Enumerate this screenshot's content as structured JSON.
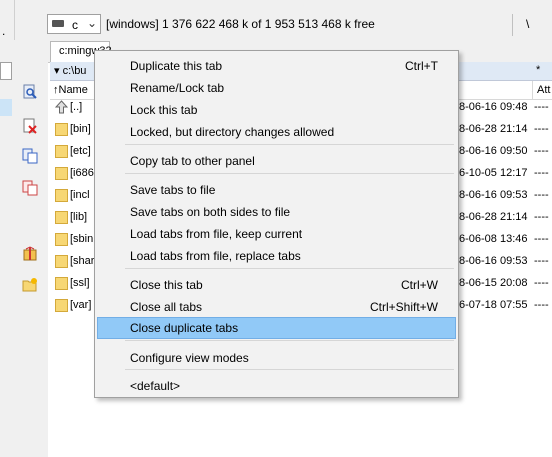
{
  "drive": {
    "letter": "c",
    "info": "[windows]  1 376 622 468 k of 1 953 513 468 k free",
    "right_sep": "\\"
  },
  "left_panel": {
    "dot": "."
  },
  "tab": {
    "label": "c:mingw32"
  },
  "path": {
    "text": "c:\\bu",
    "star": "*"
  },
  "columns": {
    "name": "↑Name",
    "attr": "Att"
  },
  "rows": [
    {
      "name": "[..]",
      "date": "8-06-16 09:48",
      "attr": "----",
      "type": "up"
    },
    {
      "name": "[bin]",
      "date": "8-06-28 21:14",
      "attr": "----",
      "type": "folder"
    },
    {
      "name": "[etc]",
      "date": "8-06-16 09:50",
      "attr": "----",
      "type": "folder"
    },
    {
      "name": "[i686",
      "date": "6-10-05 12:17",
      "attr": "----",
      "type": "folder"
    },
    {
      "name": "[incl",
      "date": "8-06-16 09:53",
      "attr": "----",
      "type": "folder"
    },
    {
      "name": "[lib]",
      "date": "8-06-28 21:14",
      "attr": "----",
      "type": "folder"
    },
    {
      "name": "[sbin",
      "date": "6-06-08 13:46",
      "attr": "----",
      "type": "folder"
    },
    {
      "name": "[shar",
      "date": "8-06-16 09:53",
      "attr": "----",
      "type": "folder"
    },
    {
      "name": "[ssl]",
      "date": "8-06-15 20:08",
      "attr": "----",
      "type": "folder"
    },
    {
      "name": "[var]",
      "date": "6-07-18 07:55",
      "attr": "----",
      "type": "folder"
    }
  ],
  "menu": {
    "items": [
      {
        "label": "Duplicate this tab",
        "shortcut": "Ctrl+T"
      },
      {
        "label": "Rename/Lock tab",
        "shortcut": ""
      },
      {
        "label": "Lock this tab",
        "shortcut": ""
      },
      {
        "label": "Locked, but directory changes allowed",
        "shortcut": ""
      },
      {
        "label": "Copy tab to other panel",
        "shortcut": ""
      },
      {
        "label": "Save tabs to file",
        "shortcut": ""
      },
      {
        "label": "Save tabs on both sides to file",
        "shortcut": ""
      },
      {
        "label": "Load tabs from file, keep current",
        "shortcut": ""
      },
      {
        "label": "Load tabs from file, replace tabs",
        "shortcut": ""
      },
      {
        "label": "Close this tab",
        "shortcut": "Ctrl+W"
      },
      {
        "label": "Close all tabs",
        "shortcut": "Ctrl+Shift+W"
      },
      {
        "label": "Close duplicate tabs",
        "shortcut": ""
      },
      {
        "label": "Configure view modes",
        "shortcut": ""
      },
      {
        "label": "<default>",
        "shortcut": ""
      }
    ],
    "highlighted": "Close duplicate tabs"
  },
  "colors": {
    "menu_highlight": "#91c9f7",
    "path_bar": "#dfe9f5",
    "folder": "#f7d774"
  },
  "icons": [
    "drive-icon",
    "chevron-down-icon",
    "up-folder-icon",
    "folder-icon",
    "search-icon",
    "copy-icon",
    "delete-icon",
    "pack-icon",
    "new-folder-icon"
  ]
}
